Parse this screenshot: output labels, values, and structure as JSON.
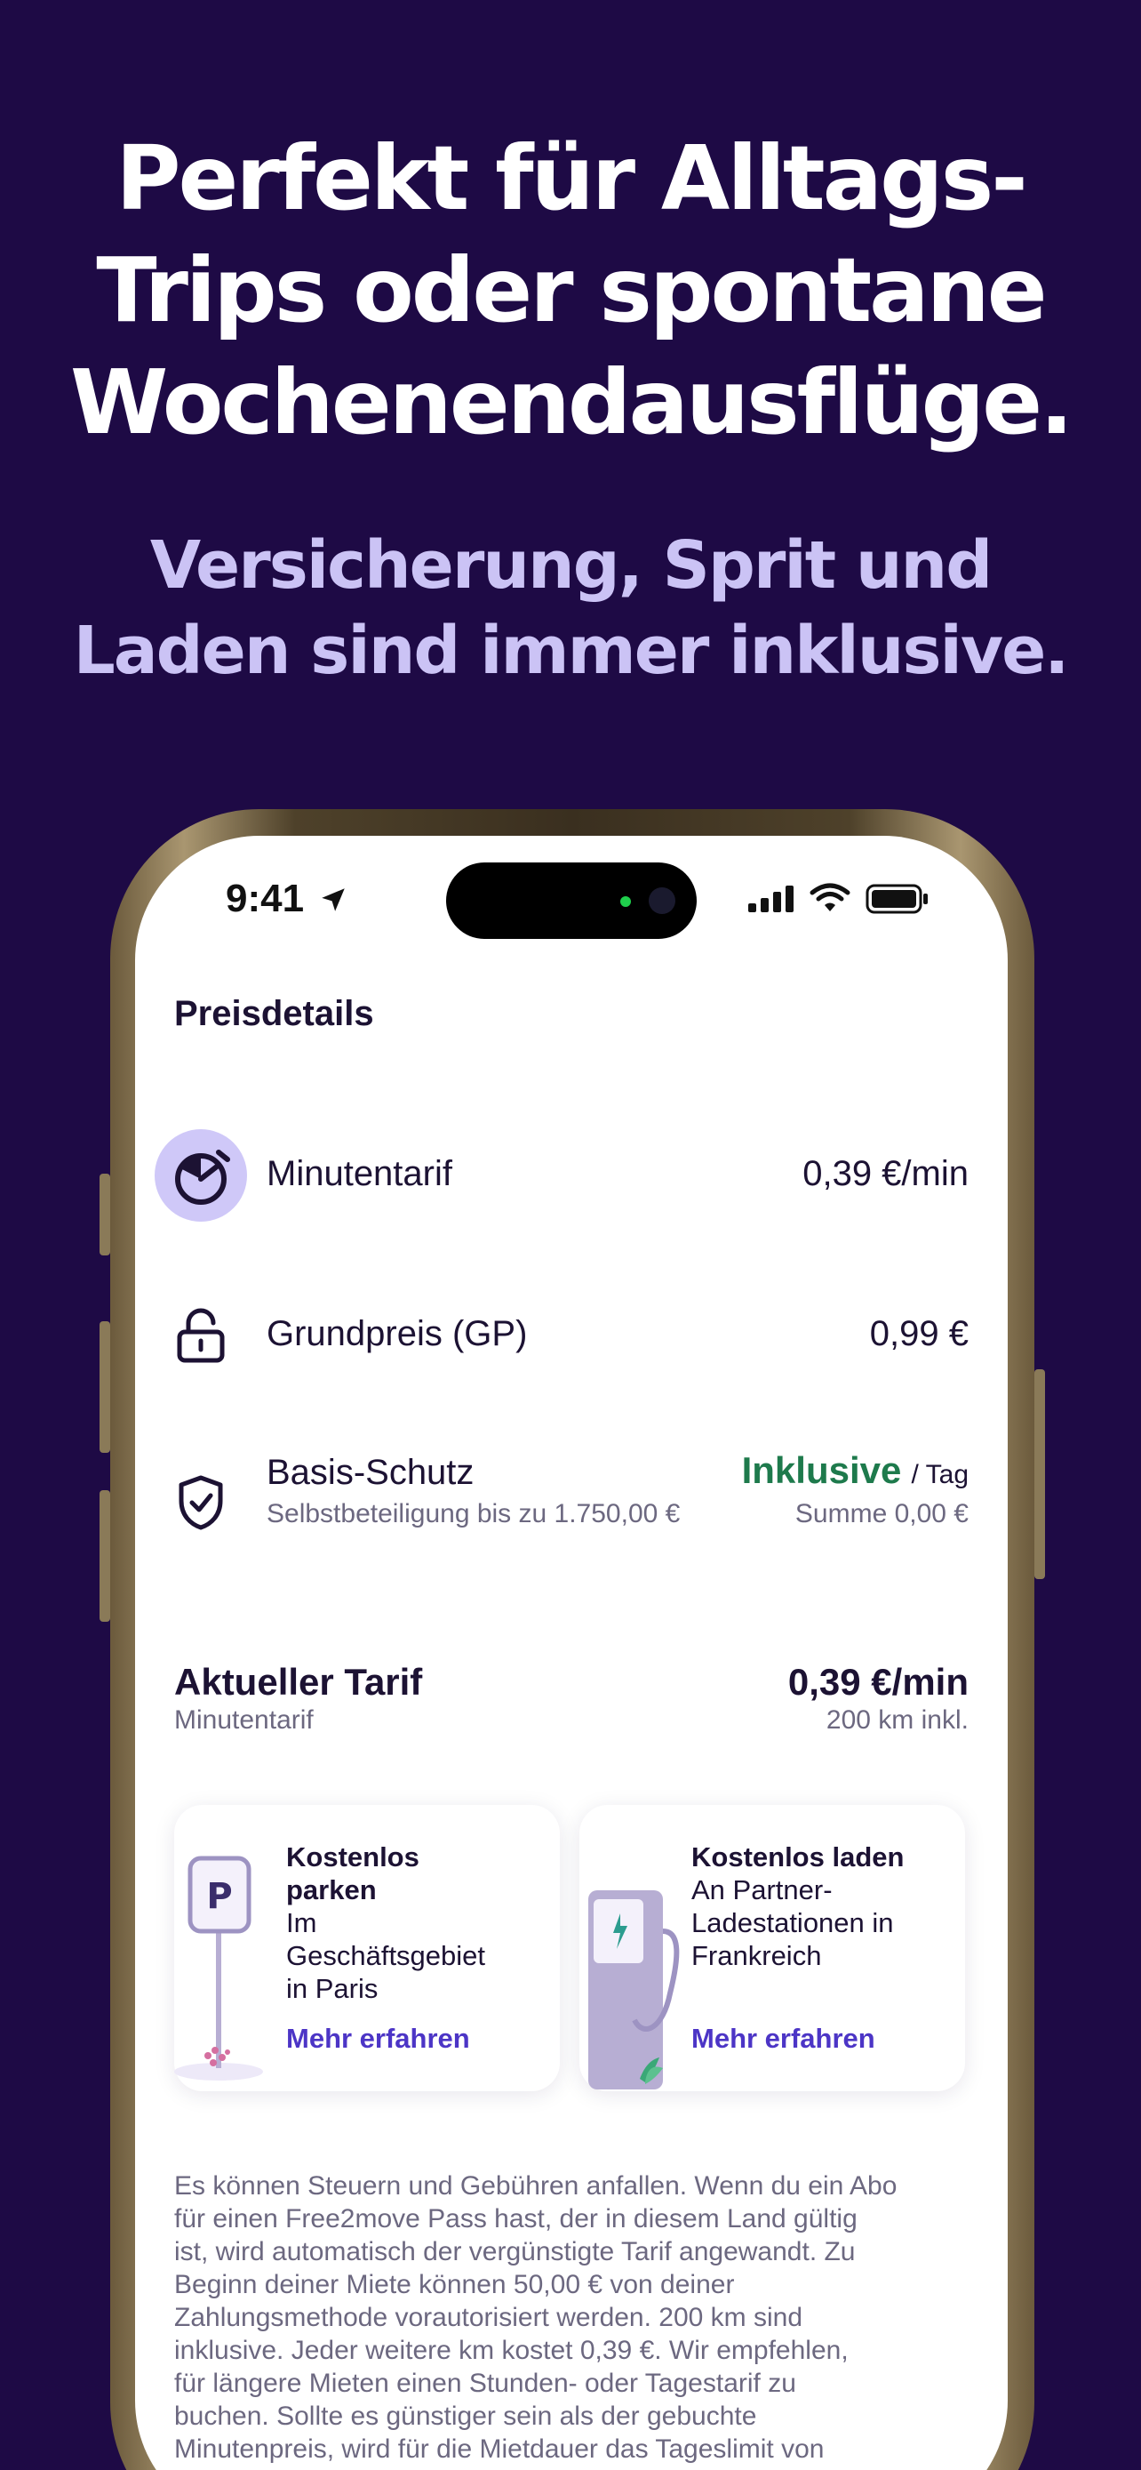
{
  "promo": {
    "headline": [
      "Perfekt für Alltags-",
      "Trips oder spontane",
      "Wochenendausflüge."
    ],
    "subline": [
      "Versicherung, Sprit und",
      "Laden sind immer inklusive."
    ]
  },
  "status_bar": {
    "time": "9:41"
  },
  "page": {
    "title": "Preisdetails"
  },
  "price_rows": {
    "minute": {
      "label": "Minutentarif",
      "value": "0,39 €/min"
    },
    "base": {
      "label": "Grundpreis (GP)",
      "value": "0,99 €"
    },
    "protection": {
      "label": "Basis-Schutz",
      "sub": "Selbstbeteiligung bis zu 1.750,00 €",
      "value": "Inklusive",
      "unit": "/ Tag",
      "sum": "Summe 0,00 €"
    }
  },
  "current_tariff": {
    "label": "Aktueller Tarif",
    "sub": "Minutentarif",
    "value": "0,39 €/min",
    "km": "200 km inkl."
  },
  "cards": [
    {
      "title_lines": [
        "Kostenlos",
        "parken"
      ],
      "text_lines": [
        "Im",
        "Geschäftsgebiet",
        "in Paris"
      ],
      "link": "Mehr erfahren"
    },
    {
      "title_lines": [
        "Kostenlos laden"
      ],
      "text_lines": [
        "An Partner-",
        "Ladestationen in",
        "Frankreich"
      ],
      "link": "Mehr erfahren"
    }
  ],
  "disclaimer_lines": [
    "Es können Steuern und Gebühren anfallen. Wenn du ein Abo",
    "für einen Free2move Pass hast, der in diesem Land gültig",
    "ist, wird automatisch der vergünstigte Tarif angewandt. Zu",
    "Beginn deiner Miete können 50,00 € von deiner",
    "Zahlungsmethode vorautorisiert werden. 200 km sind",
    "inklusive. Jeder weitere km kostet 0,39 €. Wir empfehlen,",
    "für längere Mieten einen Stunden- oder Tagestarif zu",
    "buchen. Sollte es günstiger sein als der gebuchte",
    "Minutenpreis, wird für die Mietdauer das Tageslimit von"
  ],
  "colors": {
    "background": "#1e0a45",
    "subline": "#cbc3f5",
    "included": "#1e7a4c",
    "link": "#4c35c6",
    "text": "#1c1233"
  },
  "icons": [
    "stopwatch-icon",
    "unlock-icon",
    "shield-check-icon",
    "location-arrow-icon",
    "signal-icon",
    "wifi-icon",
    "battery-icon",
    "parking-sign-icon",
    "charging-station-icon"
  ]
}
